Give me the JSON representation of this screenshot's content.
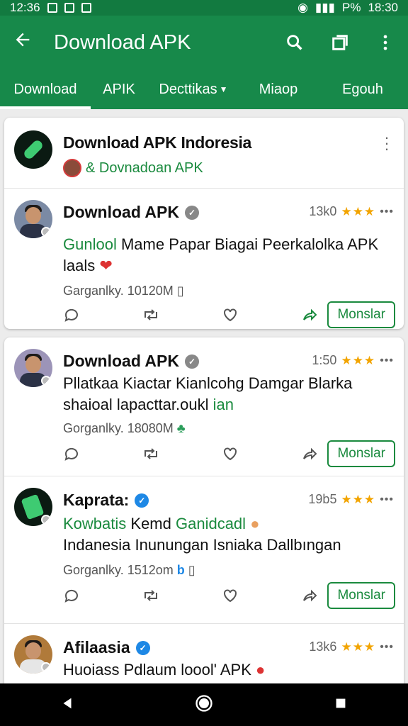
{
  "status": {
    "time_left": "12:36",
    "time_right": "18:30",
    "battery": "P%"
  },
  "appbar": {
    "title": "Download APK",
    "back_icon": "arrow-back-icon",
    "search_icon": "search-icon",
    "window_icon": "window-icon",
    "more_icon": "more-vert-icon"
  },
  "tabs": [
    {
      "label": "Download",
      "active": true
    },
    {
      "label": "APIK"
    },
    {
      "label": "Decttikas"
    },
    {
      "label": "Miaop"
    },
    {
      "label": "Egouh"
    }
  ],
  "header": {
    "title": "Download APK Indoresia",
    "subtitle": "& Dovnadoan APK"
  },
  "posts": [
    {
      "name": "Download APK",
      "time": "13k0",
      "stars": "★★★",
      "text_green": "Gunlool",
      "text": " Mame Papar Biagai Peerkalolka APK laals",
      "stat": "Garganlky. 10120M",
      "button": "Monslar"
    },
    {
      "name": "Download APK",
      "time": "1:50",
      "stars": "★★★",
      "text": "Pllatkaa Kiactar Kianlcohg Damgar Blarka shaioal lapacttar.oukl ",
      "text_green": "ian",
      "stat": "Gorganlky. 18080M",
      "button": "Monslar"
    },
    {
      "name": "Kaprata:",
      "time": "19b5",
      "stars": "★★★",
      "text_green": "Kowbatis",
      "text": " Kemd ",
      "text_green2": "Ganidcadl",
      "text2": "Indanesia Inunungan Isniaka Dallbıngan",
      "stat": "Gorganlky. 1512om",
      "button": "Monslar"
    },
    {
      "name": "Afilaasia",
      "time": "13k6",
      "stars": "★★★",
      "text": "Huoiass Pdlaum loool' APK"
    }
  ],
  "colors": {
    "brand": "#17894a",
    "accent_green": "#1a8a3e",
    "star": "#f2a400"
  }
}
